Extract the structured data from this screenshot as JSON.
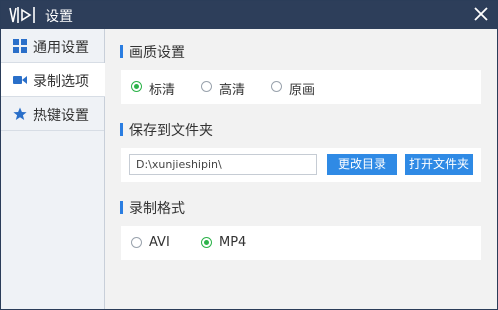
{
  "window": {
    "title": "设置"
  },
  "sidebar": {
    "items": [
      {
        "label": "通用设置",
        "icon": "grid-icon",
        "active": false
      },
      {
        "label": "录制选项",
        "icon": "video-camera-icon",
        "active": true
      },
      {
        "label": "热键设置",
        "icon": "star-icon",
        "active": false
      }
    ]
  },
  "quality": {
    "title": "画质设置",
    "options": [
      {
        "label": "标清",
        "checked": true
      },
      {
        "label": "高清",
        "checked": false
      },
      {
        "label": "原画",
        "checked": false
      }
    ]
  },
  "save": {
    "title": "保存到文件夹",
    "path": "D:\\xunjieshipin\\",
    "change_label": "更改目录",
    "open_label": "打开文件夹"
  },
  "format": {
    "title": "录制格式",
    "options": [
      {
        "label": "AVI",
        "checked": false
      },
      {
        "label": "MP4",
        "checked": true
      }
    ]
  },
  "colors": {
    "titlebar": "#2d3e5a",
    "accent": "#2a7de1",
    "radio_checked": "#2db34a",
    "button": "#2f8ae5"
  }
}
